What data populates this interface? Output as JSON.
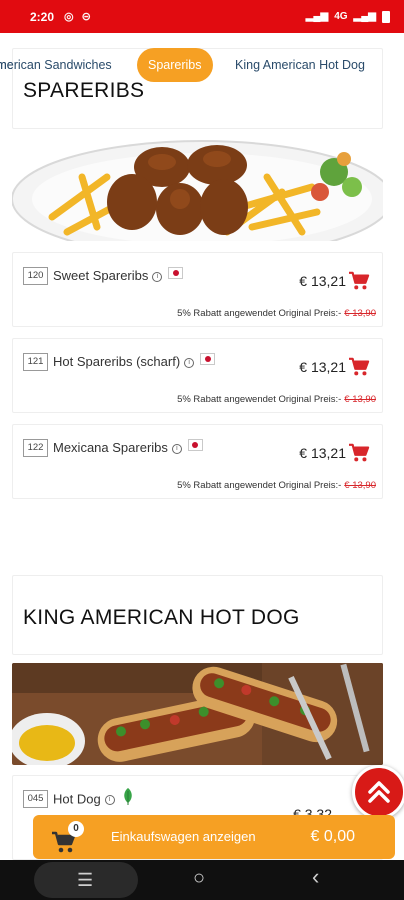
{
  "status_bar": {
    "time": "2:20",
    "right_text": "4G"
  },
  "category_nav": {
    "items": [
      {
        "label": "American Sandwiches",
        "active": false
      },
      {
        "label": "Spareribs",
        "active": true
      },
      {
        "label": "King American Hot Dog",
        "active": false
      }
    ]
  },
  "sections": [
    {
      "title": "SPARERIBS",
      "items": [
        {
          "number": "120",
          "name": "Sweet Spareribs",
          "price": "€ 13,21",
          "discount_text": "5% Rabatt angewendet Original Preis:-",
          "original_price": "€ 13,90"
        },
        {
          "number": "121",
          "name": "Hot Spareribs (scharf)",
          "price": "€ 13,21",
          "discount_text": "5% Rabatt angewendet Original Preis:-",
          "original_price": "€ 13,90"
        },
        {
          "number": "122",
          "name": "Mexicana Spareribs",
          "price": "€ 13,21",
          "discount_text": "5% Rabatt angewendet Original Preis:-",
          "original_price": "€ 13,90"
        }
      ]
    },
    {
      "title": "KING AMERICAN HOT DOG",
      "items": [
        {
          "number": "045",
          "name": "Hot Dog",
          "price": "€ 3,32"
        }
      ]
    }
  ],
  "cart": {
    "count": "0",
    "label": "Einkaufswagen anzeigen",
    "total": "€ 0,00"
  },
  "colors": {
    "status_red": "#e10b10",
    "accent_orange": "#f6a023",
    "cart_icon_red": "#d8262b",
    "scroll_btn_red": "#d81a17"
  },
  "icons": {
    "cart": "shopping-cart-icon",
    "info": "info-icon",
    "flag": "japan-flag-icon",
    "veggie": "leaf-icon",
    "scroll_top": "double-chevron-up-icon",
    "nav_menu": "menu-icon",
    "nav_home": "home-circle-icon",
    "nav_back": "back-chevron-icon"
  }
}
